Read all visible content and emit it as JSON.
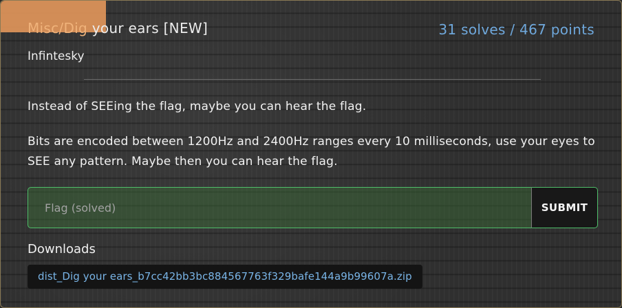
{
  "challenge": {
    "category": "Misc/Dig",
    "title_rest": " your ears [NEW]",
    "stats": "31 solves / 467 points",
    "author": "Infintesky",
    "description": [
      "Instead of SEEing the flag, maybe you can hear the flag.",
      "Bits are encoded between 1200Hz and 2400Hz ranges every 10 milliseconds, use your eyes to SEE any pattern. Maybe then you can hear the flag."
    ]
  },
  "flag_form": {
    "placeholder": "Flag (solved)",
    "value": "",
    "submit_label": "SUBMIT"
  },
  "downloads": {
    "label": "Downloads",
    "files": [
      {
        "name": "dist_Dig your ears_b7cc42bb3bc884567763f329bafe144a9b99607a.zip"
      }
    ]
  },
  "colors": {
    "tag": "#e0955a",
    "stats": "#6fa8dc",
    "success_border": "#4fbf6a",
    "link": "#79b4e6"
  }
}
